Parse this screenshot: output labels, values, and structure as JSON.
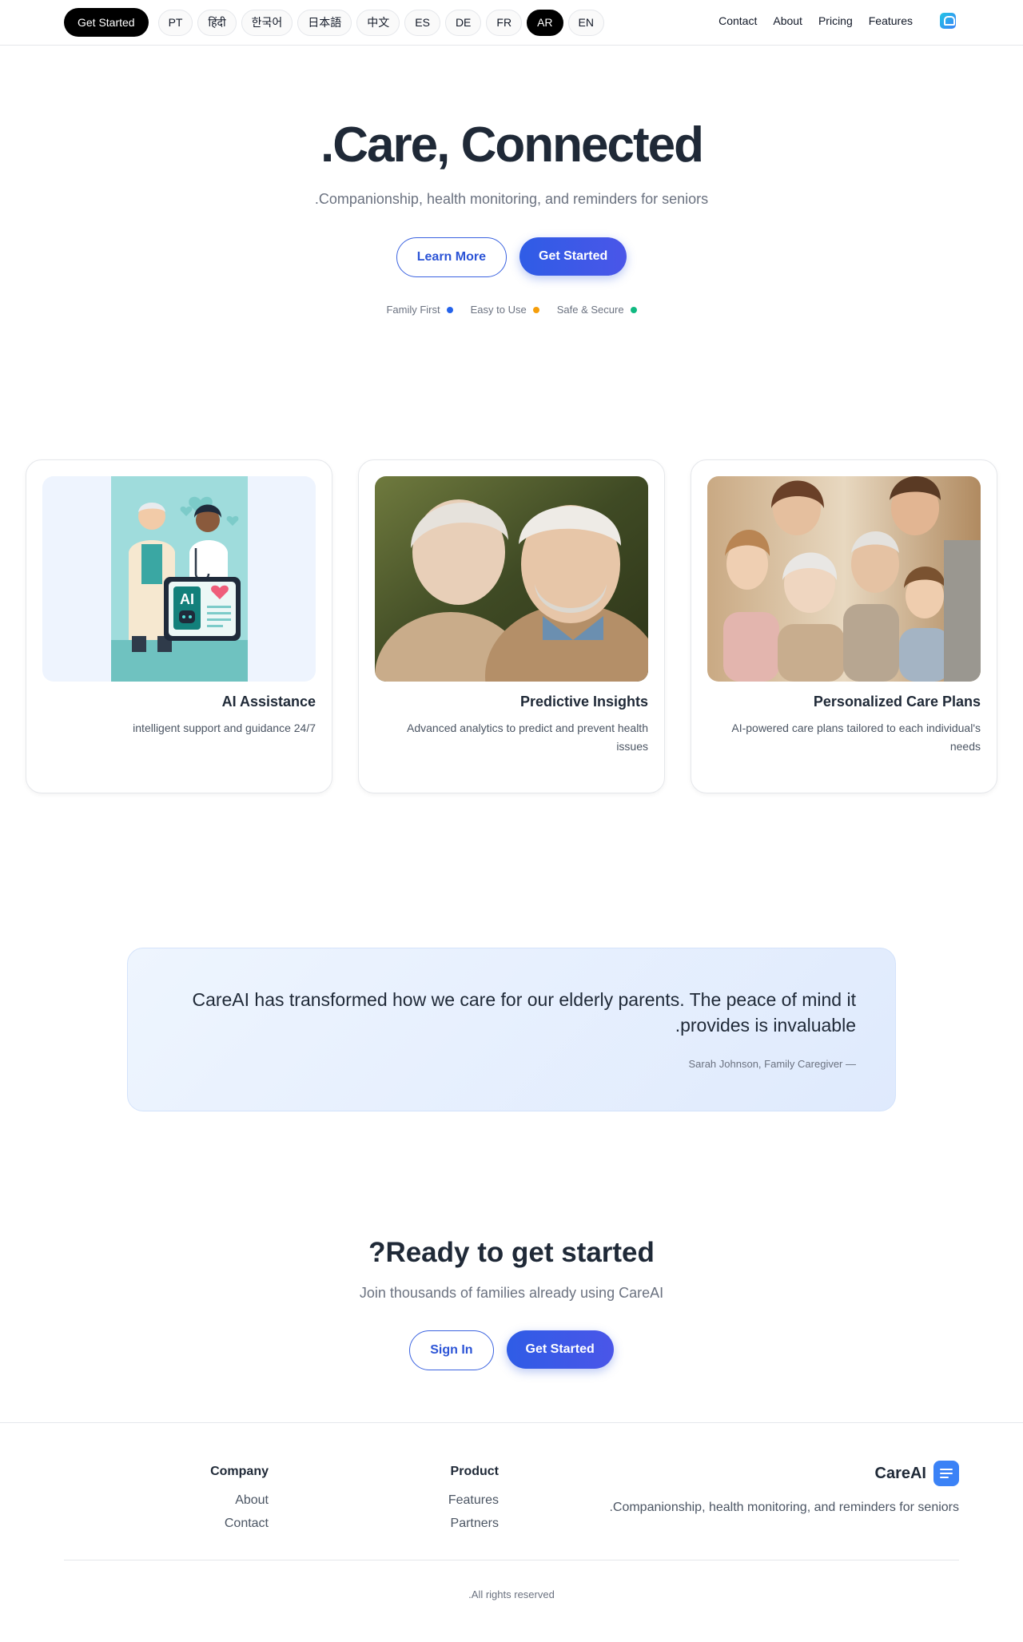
{
  "header": {
    "get_started": "Get Started",
    "languages": [
      "PT",
      "हिंदी",
      "한국어",
      "日本語",
      "中文",
      "ES",
      "DE",
      "FR",
      "AR",
      "EN"
    ],
    "active_language": "AR",
    "nav": [
      "Contact",
      "About",
      "Pricing",
      "Features"
    ]
  },
  "hero": {
    "title": ".Care, Connected",
    "subtitle": ".Companionship, health monitoring, and reminders for seniors",
    "learn_more": "Learn More",
    "get_started": "Get Started",
    "badges": [
      {
        "label": "Family First",
        "color": "#2563eb"
      },
      {
        "label": "Easy to Use",
        "color": "#f59e0b"
      },
      {
        "label": "Safe & Secure",
        "color": "#10b981"
      }
    ]
  },
  "features": [
    {
      "title": "AI Assistance",
      "description": "intelligent support and guidance 24/7",
      "image": "ai-assistance-illustration"
    },
    {
      "title": "Predictive Insights",
      "description": "Advanced analytics to predict and prevent health issues",
      "image": "elderly-couple-photo"
    },
    {
      "title": "Personalized Care Plans",
      "description": "AI-powered care plans tailored to each individual's needs",
      "image": "family-photo"
    }
  ],
  "illustration": {
    "ai_label": "AI"
  },
  "testimonial": {
    "quote": "CareAI has transformed how we care for our elderly parents. The peace of mind it .provides is invaluable",
    "author": "Sarah Johnson, Family Caregiver —"
  },
  "cta": {
    "title": "?Ready to get started",
    "subtitle": "Join thousands of families already using CareAI",
    "sign_in": "Sign In",
    "get_started": "Get Started"
  },
  "footer": {
    "company": {
      "heading": "Company",
      "links": [
        "About",
        "Contact"
      ]
    },
    "product": {
      "heading": "Product",
      "links": [
        "Features",
        "Partners"
      ]
    },
    "brand_name": "CareAI",
    "brand_tagline": ".Companionship, health monitoring, and reminders for seniors",
    "copyright": ".All rights reserved"
  }
}
